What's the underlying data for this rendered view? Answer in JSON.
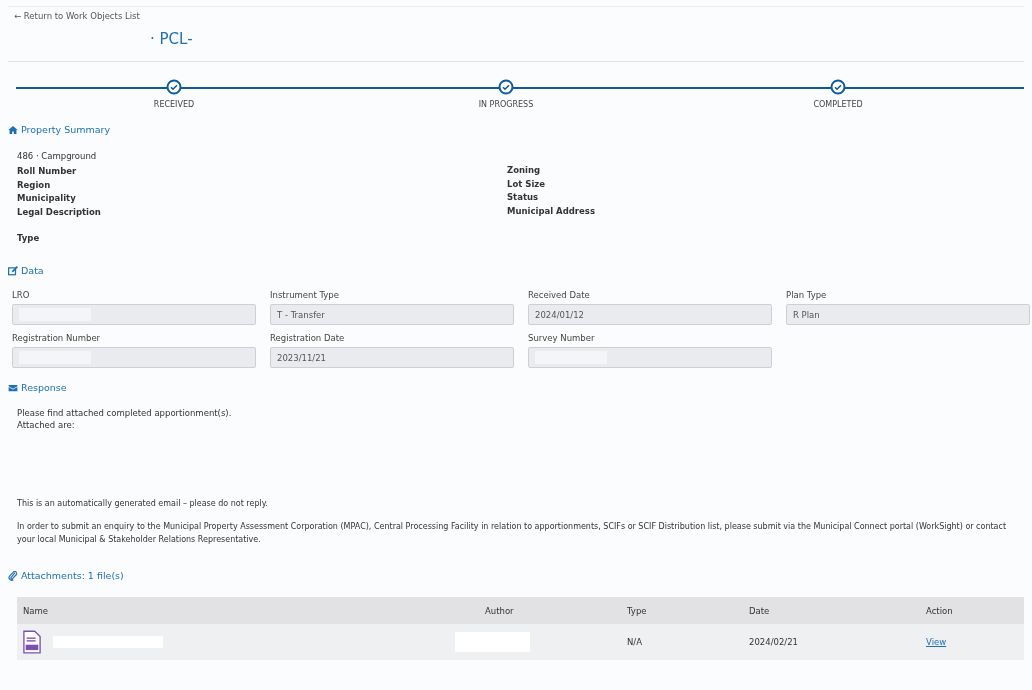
{
  "back_link": "← Return to Work Objects List",
  "title": {
    "text": "· PCL-"
  },
  "stages": [
    {
      "label": "RECEIVED",
      "completed": true
    },
    {
      "label": "IN PROGRESS",
      "completed": true
    },
    {
      "label": "COMPLETED",
      "completed": true
    }
  ],
  "property_summary": {
    "heading": "Property Summary",
    "subtitle": "486 · Campground",
    "left_labels": [
      "Roll Number",
      "Region",
      "Municipality",
      "Legal Description",
      "Type"
    ],
    "right_labels": [
      "Zoning",
      "Lot Size",
      "Status",
      "Municipal Address"
    ]
  },
  "data": {
    "heading": "Data",
    "fields": [
      {
        "label": "LRO"
      },
      {
        "label": "Instrument Type",
        "value": "T - Transfer"
      },
      {
        "label": "Received Date",
        "value": "2024/01/12"
      },
      {
        "label": "Plan Type",
        "value": "R Plan"
      },
      {
        "label": "Registration Number"
      },
      {
        "label": "Registration Date",
        "value": "2023/11/21"
      },
      {
        "label": "Survey Number"
      }
    ]
  },
  "response": {
    "heading": "Response",
    "lines": [
      "Please find attached completed apportionment(s).",
      "Attached are:"
    ],
    "notice": "This is an automatically generated email – please do not reply.",
    "enquiry": "In order to submit an enquiry to the Municipal Property Assessment Corporation (MPAC), Central Processing Facility in relation to apportionments, SCIFs or SCIF Distribution list, please submit via the Municipal Connect portal (WorkSight) or contact your local Municipal & Stakeholder Relations Representative."
  },
  "attachments": {
    "heading": "Attachments: 1 file(s)",
    "columns": [
      "Name",
      "Author",
      "Type",
      "Date",
      "Action"
    ],
    "rows": [
      {
        "type": "N/A",
        "date": "2024/02/21",
        "action": "View"
      }
    ]
  }
}
